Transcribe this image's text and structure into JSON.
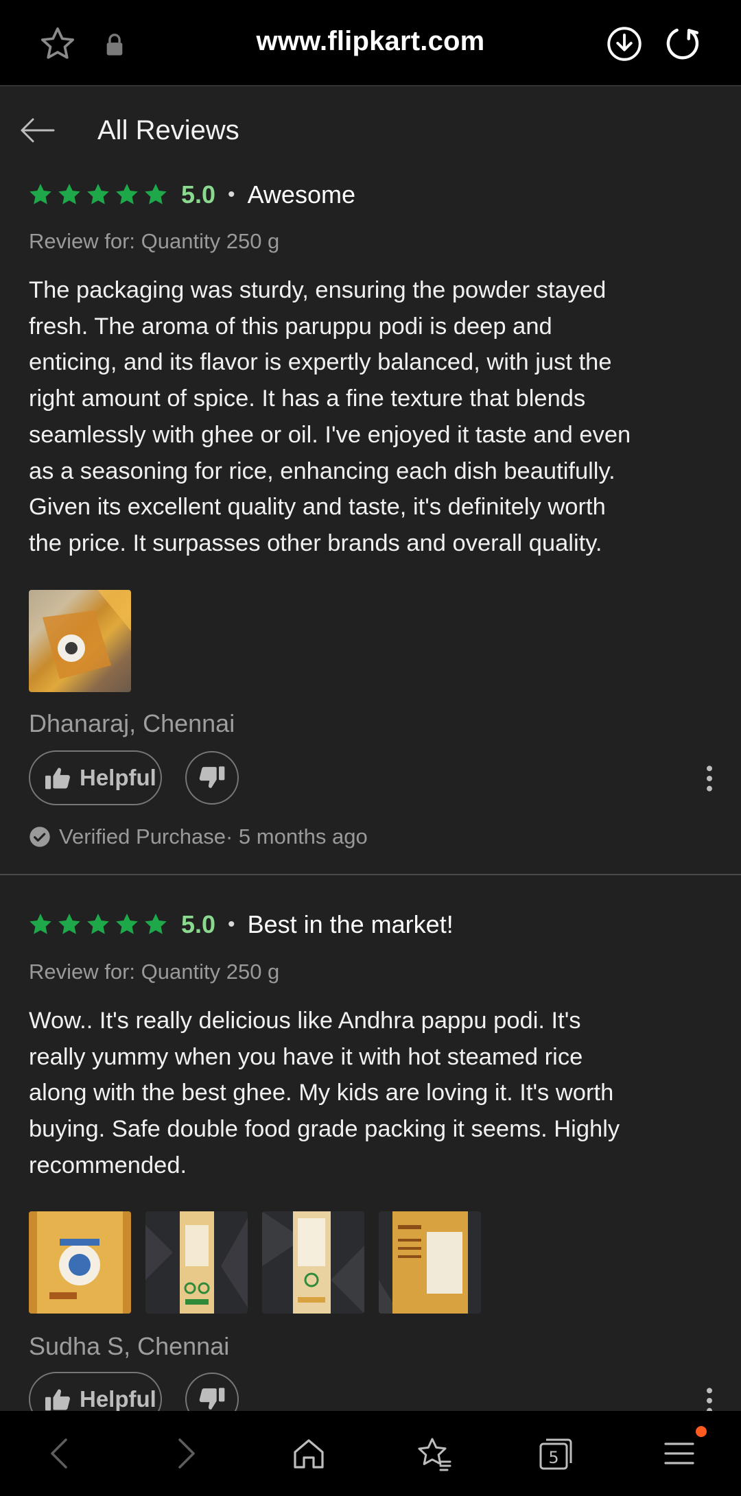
{
  "browser": {
    "url": "www.flipkart.com",
    "icons": [
      "star-icon",
      "lock-icon",
      "download-icon",
      "reload-icon"
    ]
  },
  "header": {
    "title": "All Reviews"
  },
  "reviews": [
    {
      "stars": 5,
      "score": "5.0",
      "separator": "•",
      "title": "Awesome",
      "review_for": "Review for: Quantity 250 g",
      "lines": [
        "The packaging was sturdy, ensuring the powder stayed",
        "fresh. The aroma of this paruppu podi is deep and",
        "enticing, and its flavor is expertly balanced, with just the",
        "right amount of spice. It has a fine texture that blends",
        "seamlessly with ghee or oil. I've enjoyed it taste and even",
        "as a seasoning for rice, enhancing each dish beautifully.",
        "Given its excellent quality and taste, it's definitely worth",
        "the price. It surpasses other brands and overall quality."
      ],
      "photo_count": 1,
      "author": "Dhanaraj, Chennai",
      "helpful_label": "Helpful",
      "verified": "Verified Purchase· 5 months ago"
    },
    {
      "stars": 5,
      "score": "5.0",
      "separator": "•",
      "title": "Best in the market!",
      "review_for": "Review for: Quantity 250 g",
      "lines": [
        "Wow.. It's really delicious like Andhra pappu podi. It's",
        "really yummy when you have it with hot steamed rice",
        "along with the best ghee. My kids are loving it. It's worth",
        "buying. Safe double food grade packing it seems. Highly",
        "recommended."
      ],
      "photo_count": 4,
      "author": "Sudha S, Chennai",
      "helpful_label": "Helpful"
    }
  ],
  "bottom_nav": {
    "tab_count": "5",
    "icons": [
      "back-icon",
      "forward-icon",
      "home-icon",
      "bookmarks-icon",
      "tabs-icon",
      "menu-icon"
    ]
  },
  "colors": {
    "background": "#212121",
    "star_green": "#1fa84a",
    "score_green": "#8bd98f",
    "notification_dot": "#ff5a1f"
  }
}
